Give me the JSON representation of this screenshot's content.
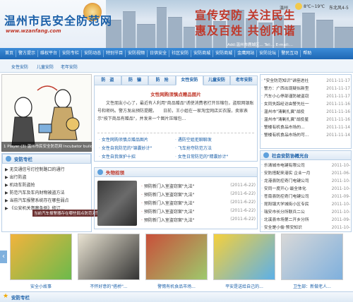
{
  "header": {
    "title": "温州市民安全防范网",
    "url": "www.wzanfang.com",
    "slogan_line1": "宣传安防 关注民生",
    "slogan_line2": "惠及百姓 共创和谐",
    "address": "Add:温州市鹿城区... Tel:... E-mail:..."
  },
  "nav": {
    "items": [
      "首页",
      "警方提示",
      "维权平台",
      "安防专栏",
      "安防动态",
      "特别节目",
      "安防视频",
      "日供安全",
      "社区安防",
      "安防商城",
      "安防商城",
      "金鹰网站",
      "安防论坛",
      "警民互动",
      "帮助"
    ]
  },
  "subnav": {
    "tags": [
      "女性安防",
      "儿童安防",
      "老年安防"
    ],
    "weather_city": "温州",
    "weather_temp": "8℃~19℃",
    "weather_wind": "东北风4-5"
  },
  "cartoon": {
    "caption": "1 Player (3) 温州市民安全防范网 Incubator build"
  },
  "tips": {
    "title": "安防专栏",
    "items": [
      "▶ 无交通信号灯控制路口的通行",
      "▶ 出行防盗",
      "▶ 机动车防盗抢",
      "▶ 防范汽车及车内财物被盗方法",
      "▶ 当前汽车报警系统存在哪些弱点",
      "▶ 《公安机关督察条例》修订..."
    ],
    "overlay": "当前汽车报警器存在哪些弱点防范对策"
  },
  "tabs": {
    "items": [
      "防　盗",
      "防　骗",
      "防　抢",
      "女性安防",
      "儿童安防",
      "老年安防"
    ],
    "active_index": 3
  },
  "feature": {
    "title": "女性网购须慎点赠品图片",
    "summary": "　　文性朋友小心了，最近有人利用\"商品赠品\"诱使消费者打开压缩包，盗取网银账号和密码。警方发出预防提醒。　　日前，王小姐在一家淘宝网店买衣服，卖家表示\"按下商品有赠品\"，并发来一个图片压缩包...",
    "links": [
      "女性网购须慎点赠品图片",
      "女性安防——提防防盗",
      "女性自我保护十招",
      "遇防空姐拒聊聊发",
      "飞车抢夺防范方法",
      "女性日常防范的\"精囊妙计\""
    ],
    "link2": "女性自我防范的\"锦囊妙计\""
  },
  "recall": {
    "title": "失物招领",
    "rows": [
      {
        "t": "预防新门入室盗窃案\"九法\"",
        "d": "(2011-6-22)"
      },
      {
        "t": "预防新门入室盗窃案\"九法\"",
        "d": "(2011-6-22)"
      },
      {
        "t": "预防新门入室盗窃案\"九法\"",
        "d": "(2011-6-22)"
      },
      {
        "t": "预防新门入室盗窃案\"九法\"",
        "d": "(2011-6-22)"
      },
      {
        "t": "预防新门入室盗窃案\"九法\"",
        "d": "(2011-6-22)"
      }
    ]
  },
  "news": {
    "rows": [
      {
        "t": "\"安全防范知识\"讲座进社",
        "d": "2011-11-17"
      },
      {
        "t": "警方：广西出现疑似新型",
        "d": "2011-11-17"
      },
      {
        "t": "汽车小心停部谨防被盗窃",
        "d": "2011-11-17"
      },
      {
        "t": "女同失踪经访由警先社一",
        "d": "2011-11-16"
      },
      {
        "t": "温州市\"清剿扎冀\"战役",
        "d": "2011-11-16"
      },
      {
        "t": "温州市\"清剿扎冀\"战役星",
        "d": "2011-11-16"
      },
      {
        "t": "警楼有机食品市场的...",
        "d": "2011-11-14"
      },
      {
        "t": "警楼有机食品市场的可...",
        "d": "2011-11-14"
      }
    ]
  },
  "unit": {
    "title": "社会安防协概光台",
    "rows": [
      {
        "t": "乐清城市电键有限公司",
        "d": "2011-10-"
      },
      {
        "t": "安防搭配来港实 企业一月",
        "d": "2011-06-"
      },
      {
        "t": "龙港县防控奇门电键公司",
        "d": "2011-10-"
      },
      {
        "t": "安同一度开心·最全体化",
        "d": "2011-10-"
      },
      {
        "t": "苍南县防控奇门电键公司",
        "d": "2011-09-"
      },
      {
        "t": "昆阳镇大学城街小区专民",
        "d": "2011-10-"
      },
      {
        "t": "瑞安市长分所联兵二公",
        "d": "2011-10-"
      },
      {
        "t": "北溪县市场第二开乡分所",
        "d": "2011-09-"
      },
      {
        "t": "安全是小偷·预安知识",
        "d": "2011-10-"
      }
    ]
  },
  "gallery": {
    "items": [
      {
        "cap": "安全小故事",
        "c1": "#f2b33d",
        "c2": "#6cba4b"
      },
      {
        "cap": "不怀好意的\"搭桥\"...",
        "c1": "#e9e3d2",
        "c2": "#333333"
      },
      {
        "cap": "警惕有机食品市场...",
        "c1": "#c94f3a",
        "c2": "#9ec96c"
      },
      {
        "cap": "平安是送给自己的...",
        "c1": "#f5d03c",
        "c2": "#5cb0e8"
      },
      {
        "cap": "卫生部：新做老人...",
        "c1": "#d8d8d8",
        "c2": "#7fb0dd"
      }
    ]
  },
  "footer": {
    "title": "安防专栏"
  },
  "colors": {
    "brand_blue": "#1a5fa8",
    "accent_red": "#c0392b",
    "nav_blue": "#1e67b4"
  }
}
